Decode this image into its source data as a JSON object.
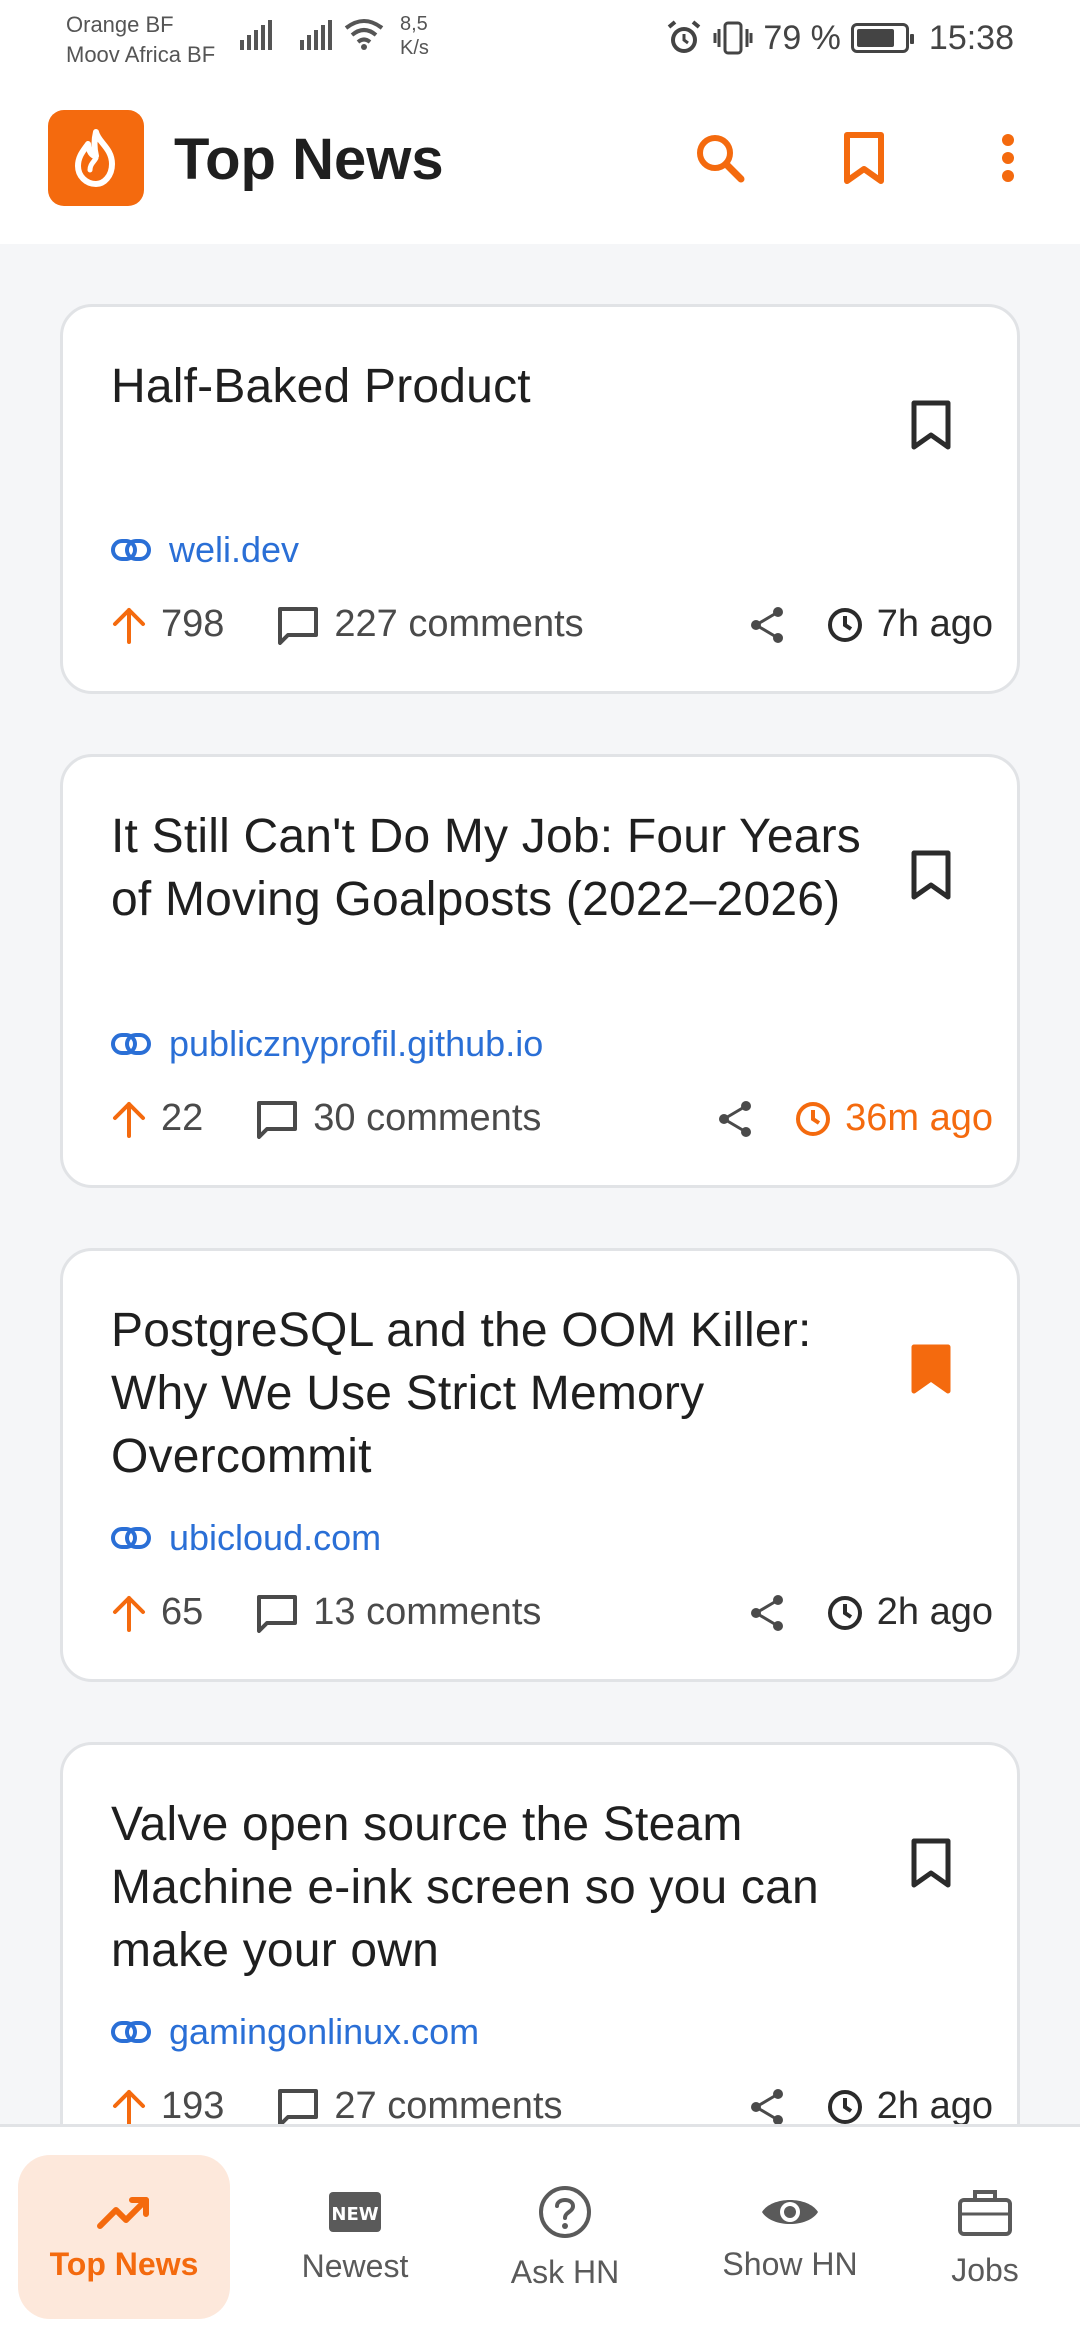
{
  "status_bar": {
    "carrier_1": "Orange BF",
    "carrier_2": "Moov Africa BF",
    "speed_value": "8,5",
    "speed_unit": "K/s",
    "battery": "79 %",
    "time": "15:38"
  },
  "app": {
    "title": "Top News",
    "accent_color": "#f46a0e",
    "logo_icon": "flame-icon",
    "actions": [
      "search-icon",
      "bookmark-icon",
      "more-vert-icon"
    ]
  },
  "stories": [
    {
      "title": "Half-Baked Product",
      "domain": "weli.dev",
      "points": "798",
      "comments": "227 comments",
      "time": "7h ago",
      "bookmarked": false,
      "recent": false
    },
    {
      "title": "It Still Can't Do My Job: Four Years of Moving Goalposts (2022–2026)",
      "domain": "publicznyprofil.github.io",
      "points": "22",
      "comments": "30 comments",
      "time": "36m ago",
      "bookmarked": false,
      "recent": true
    },
    {
      "title": "PostgreSQL and the OOM Killer: Why We Use Strict Memory Overcommit",
      "domain": "ubicloud.com",
      "points": "65",
      "comments": "13 comments",
      "time": "2h ago",
      "bookmarked": true,
      "recent": false
    },
    {
      "title": "Valve open source the Steam Machine e-ink screen so you can make your own",
      "domain": "gamingonlinux.com",
      "points": "193",
      "comments": "27 comments",
      "time": "2h ago",
      "bookmarked": false,
      "recent": false
    }
  ],
  "bottom_nav": [
    {
      "label": "Top News",
      "icon": "trending-up-icon",
      "active": true
    },
    {
      "label": "Newest",
      "icon": "new-badge-icon",
      "active": false
    },
    {
      "label": "Ask HN",
      "icon": "help-circle-icon",
      "active": false
    },
    {
      "label": "Show HN",
      "icon": "eye-icon",
      "active": false
    },
    {
      "label": "Jobs",
      "icon": "briefcase-icon",
      "active": false
    }
  ],
  "new_badge_text": "NEW"
}
